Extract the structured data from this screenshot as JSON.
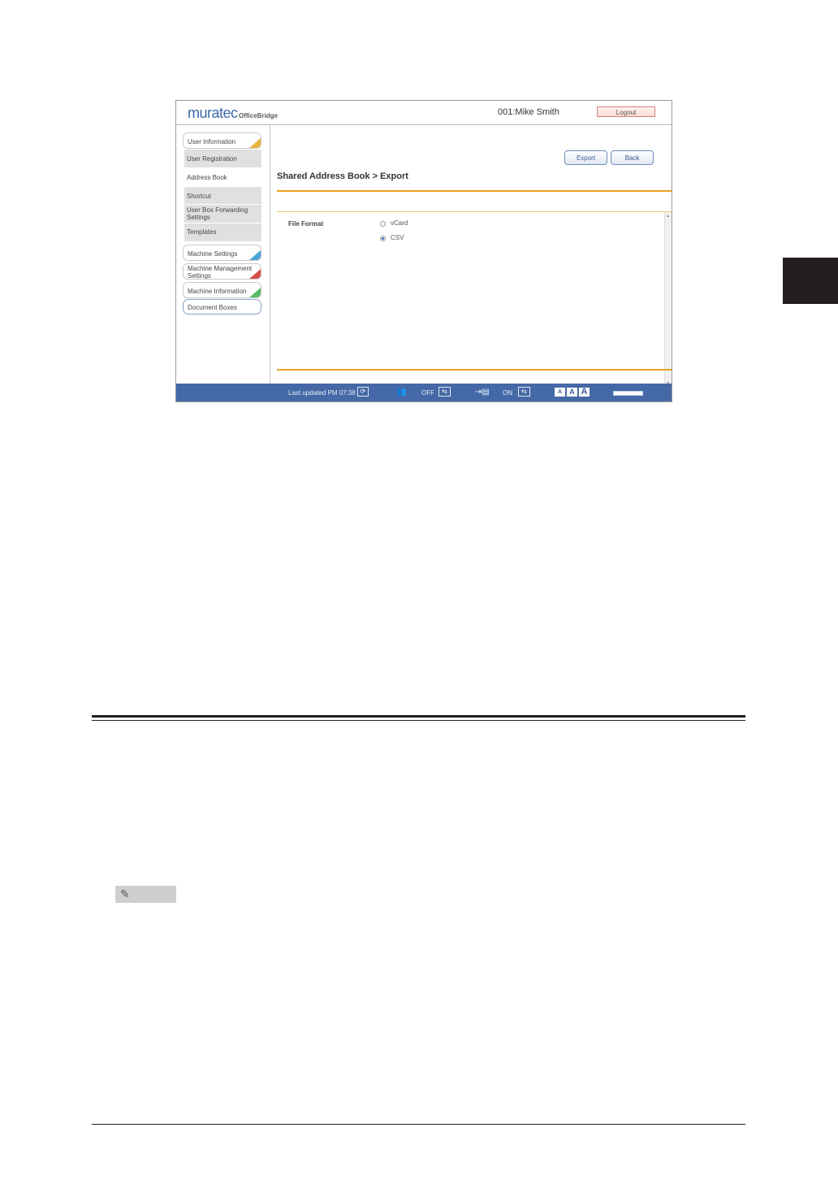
{
  "app": {
    "logo": "muratec",
    "logo_sub": "OfficeBridge",
    "user": "001:Mike Smith",
    "logout_label": "Logout"
  },
  "sidebar": {
    "items": [
      {
        "label": "User Information"
      },
      {
        "label": "User Registration"
      },
      {
        "label": "Address Book"
      },
      {
        "label": "Shortcut"
      },
      {
        "label": "User Box Forwarding Settings"
      },
      {
        "label": "Templates"
      },
      {
        "label": "Machine Settings"
      },
      {
        "label": "Machine Management Settings"
      },
      {
        "label": "Machine Information"
      },
      {
        "label": "Document Boxes"
      }
    ]
  },
  "main": {
    "export_label": "Export",
    "back_label": "Back",
    "title": "Shared Address Book > Export",
    "file_format_label": "File Format",
    "options": [
      {
        "label": "vCard",
        "selected": false
      },
      {
        "label": "CSV",
        "selected": true
      }
    ]
  },
  "status_bar": {
    "last_updated": "Last updated PM 07:38",
    "toggle1": "OFF",
    "toggle2": "ON",
    "font_sizes": [
      "A",
      "A",
      "A"
    ]
  },
  "colors": {
    "accent_orange": "#e8a21c",
    "status_bar_blue": "#4569a6",
    "link_blue": "#3a5e96"
  }
}
